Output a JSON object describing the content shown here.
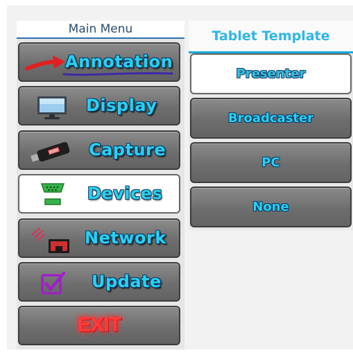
{
  "main_menu": {
    "title": "Main Menu",
    "items": [
      {
        "label": "Annotation",
        "icon": "red-arrow-icon",
        "active": false
      },
      {
        "label": "Display",
        "icon": "monitor-icon",
        "active": false
      },
      {
        "label": "Capture",
        "icon": "usb-stick-icon",
        "active": false
      },
      {
        "label": "Devices",
        "icon": "serial-port-icon",
        "active": true
      },
      {
        "label": "Network",
        "icon": "network-port-icon",
        "active": false
      },
      {
        "label": "Update",
        "icon": "checkbox-icon",
        "active": false
      },
      {
        "label": "EXIT",
        "icon": "exit-icon",
        "active": false
      }
    ]
  },
  "tablet_template": {
    "title": "Tablet Template",
    "options": [
      {
        "label": "Presenter",
        "active": true
      },
      {
        "label": "Broadcaster",
        "active": false
      },
      {
        "label": "PC",
        "active": false
      },
      {
        "label": "None",
        "active": false
      }
    ]
  },
  "colors": {
    "label_cyan": "#2ad0f0",
    "exit_red": "#ff3030",
    "accent_blue": "#1aa7d8"
  }
}
